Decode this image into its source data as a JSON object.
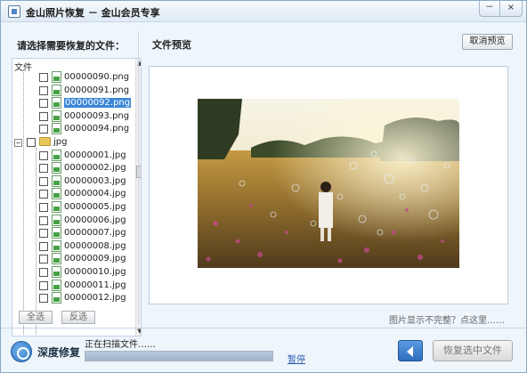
{
  "window": {
    "title": "金山照片恢复 － 金山会员专享",
    "minimize_label": "－",
    "close_label": "×"
  },
  "left_panel": {
    "heading": "请选择需要恢复的文件：",
    "root_label": "文件",
    "png_files": [
      "00000090.png",
      "00000091.png",
      "00000092.png",
      "00000093.png",
      "00000094.png"
    ],
    "selected_file": "00000092.png",
    "folder_label": "jpg",
    "jpg_files": [
      "00000001.jpg",
      "00000002.jpg",
      "00000003.jpg",
      "00000004.jpg",
      "00000005.jpg",
      "00000006.jpg",
      "00000007.jpg",
      "00000008.jpg",
      "00000009.jpg",
      "00000010.jpg",
      "00000011.jpg",
      "00000012.jpg"
    ],
    "select_all_label": "全选",
    "invert_label": "反选"
  },
  "preview": {
    "title": "文件预览",
    "cancel_label": "取消预览",
    "incomplete_hint": "图片显示不完整？点这里……"
  },
  "bottom": {
    "mode_label": "深度修复",
    "scan_status": "正在扫描文件……",
    "progress_fraction": 1.0,
    "pause_label": "暂停",
    "recover_label": "恢复选中文件"
  }
}
